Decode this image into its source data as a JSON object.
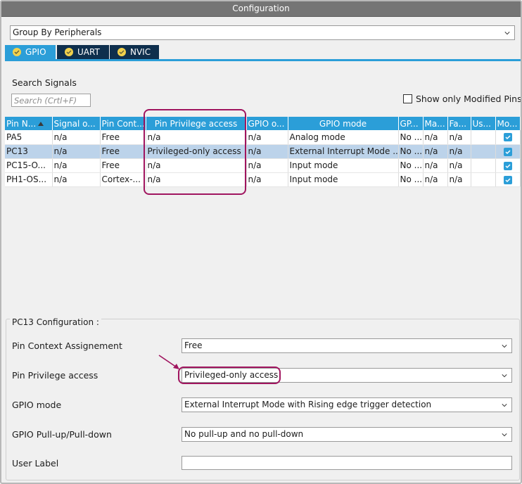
{
  "window": {
    "title": "Configuration"
  },
  "group_by": {
    "value": "Group By Peripherals"
  },
  "tabs": [
    {
      "label": "GPIO",
      "active": true
    },
    {
      "label": "UART",
      "active": false
    },
    {
      "label": "NVIC",
      "active": false
    }
  ],
  "search": {
    "label": "Search Signals",
    "placeholder": "Search (Crtl+F)"
  },
  "show_modified": {
    "label": "Show only Modified Pins",
    "checked": false
  },
  "table": {
    "columns": [
      "Pin N...",
      "Signal o...",
      "Pin Cont...",
      "Pin Privilege access",
      "GPIO o...",
      "GPIO mode",
      "GP...",
      "Ma...",
      "Fa...",
      "Us...",
      "Mo..."
    ],
    "rows": [
      {
        "pin": "PA5",
        "signal": "n/a",
        "context": "Free",
        "privilege": "n/a",
        "gpio_output": "n/a",
        "gpio_mode": "Analog mode",
        "gp": "No ...",
        "ma": "n/a",
        "fa": "n/a",
        "us": "",
        "modified": true,
        "selected": false
      },
      {
        "pin": "PC13",
        "signal": "n/a",
        "context": "Free",
        "privilege": "Privileged-only access",
        "gpio_output": "n/a",
        "gpio_mode": "External Interrupt Mode ...",
        "gp": "No ...",
        "ma": "n/a",
        "fa": "n/a",
        "us": "",
        "modified": true,
        "selected": true
      },
      {
        "pin": "PC15-O...",
        "signal": "n/a",
        "context": "Free",
        "privilege": "n/a",
        "gpio_output": "n/a",
        "gpio_mode": "Input mode",
        "gp": "No ...",
        "ma": "n/a",
        "fa": "n/a",
        "us": "",
        "modified": true,
        "selected": false
      },
      {
        "pin": "PH1-OS...",
        "signal": "n/a",
        "context": "Cortex-...",
        "privilege": "n/a",
        "gpio_output": "n/a",
        "gpio_mode": "Input mode",
        "gp": "No ...",
        "ma": "n/a",
        "fa": "n/a",
        "us": "",
        "modified": true,
        "selected": false
      }
    ]
  },
  "config": {
    "title": "PC13 Configuration :",
    "fields": {
      "pin_context": {
        "label": "Pin Context Assignement",
        "value": "Free"
      },
      "pin_privilege": {
        "label": "Pin Privilege access",
        "value": "Privileged-only access"
      },
      "gpio_mode": {
        "label": "GPIO mode",
        "value": "External Interrupt Mode with Rising edge trigger detection"
      },
      "pull": {
        "label": "GPIO Pull-up/Pull-down",
        "value": "No pull-up and no pull-down"
      },
      "user_label": {
        "label": "User Label",
        "value": ""
      }
    }
  },
  "colors": {
    "header": "#2b9ed8",
    "tab_inactive": "#0e2f4d",
    "highlight": "#a0155f",
    "selected_row": "#bcd3ea",
    "titlebar": "#757575"
  },
  "icons": {
    "tab_status": "check-circle-icon",
    "dropdown": "chevron-down-icon",
    "sort": "sort-ascending-icon",
    "annotation": "arrow-icon"
  }
}
